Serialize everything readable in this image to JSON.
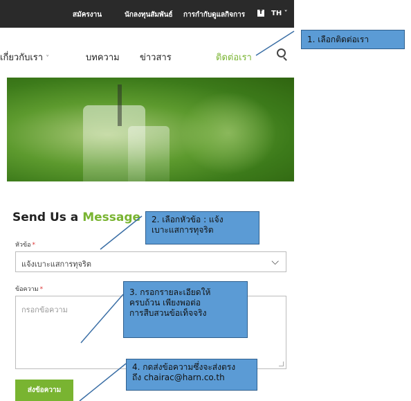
{
  "topbar": {
    "links": [
      "สมัครงาน",
      "นักลงทุนสัมพันธ์",
      "การกำกับดูแลกิจการ"
    ],
    "facebook_icon": "facebook-icon",
    "language": "TH ˅"
  },
  "nav": {
    "items": [
      {
        "label": "เกี่ยวกับเรา",
        "dropdown": true
      },
      {
        "label": "บทความ"
      },
      {
        "label": "ข่าวสาร"
      },
      {
        "label": "ติดต่อเรา",
        "active": true
      }
    ],
    "search_icon": "search-icon",
    "chevron": "˅"
  },
  "form": {
    "title_part1": "Send Us a ",
    "title_part2": "Message",
    "subject_label": "หัวข้อ",
    "subject_value": "แจ้งเบาะแสการทุจริต",
    "message_label": "ข้อความ",
    "message_placeholder": "กรอกข้อความ",
    "required_mark": "*",
    "submit_label": "ส่งข้อความ",
    "select_caret": "⌵"
  },
  "callouts": [
    {
      "text": "1. เลือกติดต่อเรา"
    },
    {
      "line1": "2. เลือกหัวข้อ : แจ้ง",
      "line2": "เบาะแสการทุจริต"
    },
    {
      "line1": "3. กรอกรายละเอียดให้",
      "line2": "ครบถ้วน เพียงพอต่อ",
      "line3": "การสืบสวนข้อเท็จจริง"
    },
    {
      "line1": "4. กดส่งข้อความซึ่งจะส่งตรง",
      "line2": "ถึง chairac@harn.co.th"
    }
  ],
  "colors": {
    "accent": "#79b431",
    "topbar": "#2a2a2a",
    "callout": "#5b9bd5"
  }
}
